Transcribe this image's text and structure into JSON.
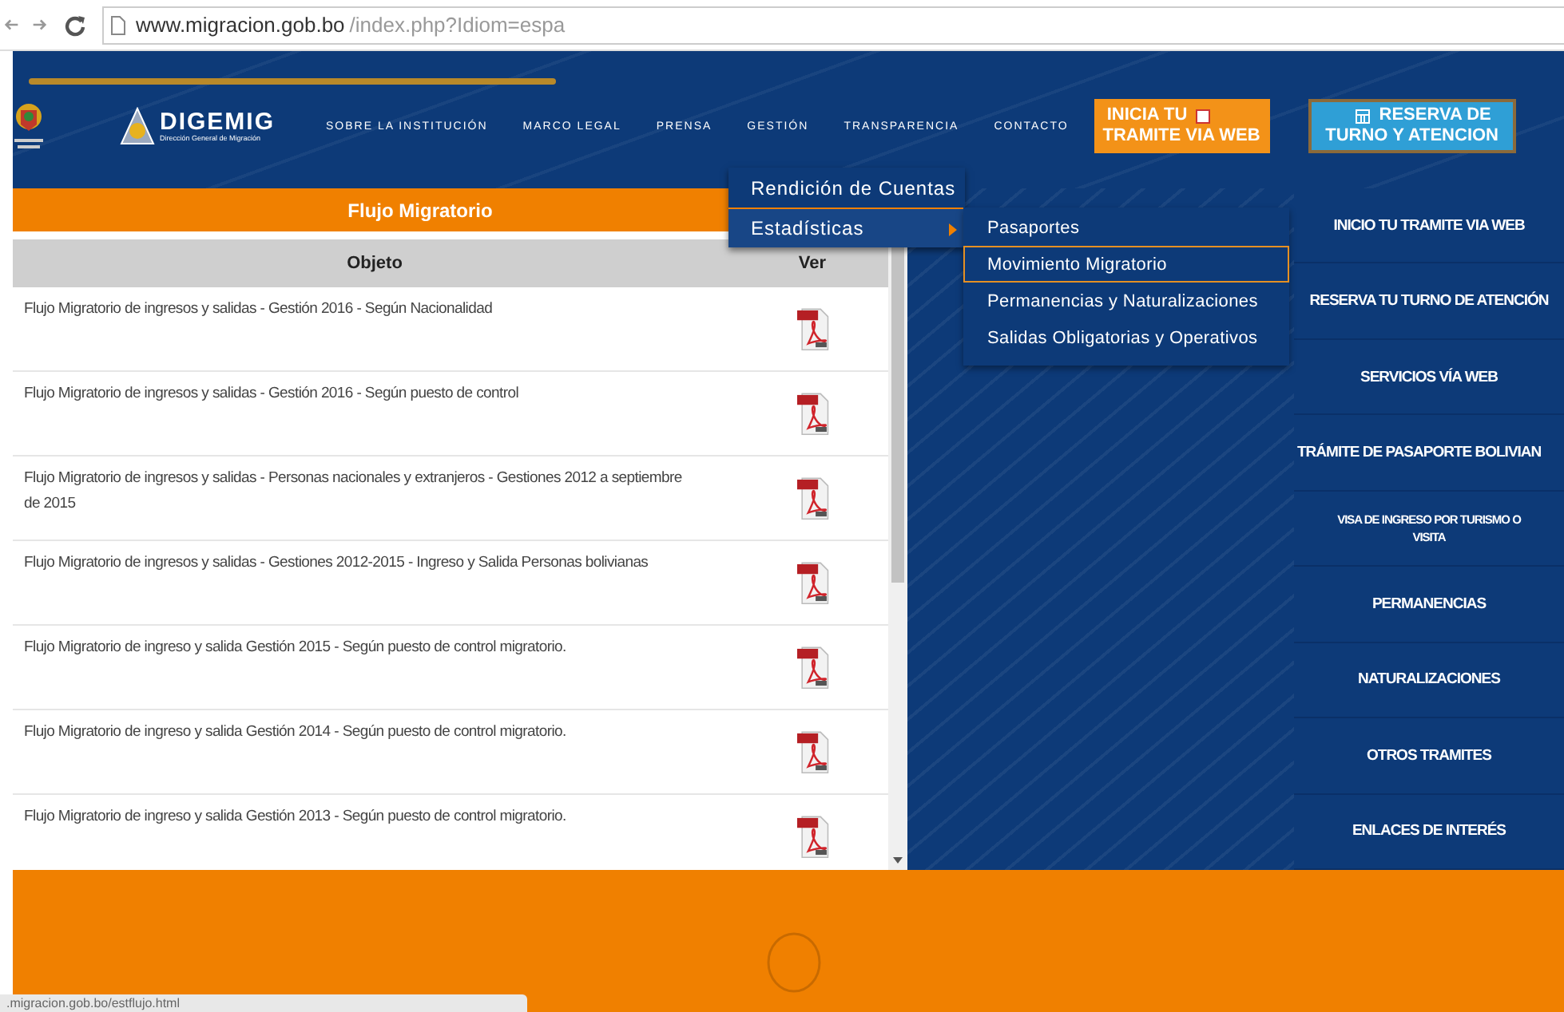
{
  "browser": {
    "url_host": "www.migracion.gob.bo",
    "url_path": "/index.php?Idiom=espa"
  },
  "header": {
    "logo_name": "DIGEMIG",
    "logo_tagline": "Dirección General de Migración",
    "nav": [
      "SOBRE LA INSTITUCIÓN",
      "MARCO LEGAL",
      "PRENSA",
      "GESTIÓN",
      "TRANSPARENCIA",
      "CONTACTO"
    ]
  },
  "banners": [
    {
      "kind": "orange",
      "lines": [
        "INICIA TU",
        "TRAMITE VIA WEB"
      ]
    },
    {
      "kind": "blue",
      "lines": [
        "RESERVA DE",
        "TURNO Y ATENCION"
      ]
    }
  ],
  "menu": {
    "items": [
      {
        "label": "Rendición de Cuentas",
        "selected": false,
        "has_submenu": false
      },
      {
        "label": "Estadísticas",
        "selected": true,
        "has_submenu": true
      }
    ],
    "submenu": [
      {
        "label": "Pasaportes",
        "selected": false
      },
      {
        "label": "Movimiento Migratorio",
        "selected": true
      },
      {
        "label": "Permanencias y Naturalizaciones",
        "selected": false
      },
      {
        "label": "Salidas Obligatorias y Operativos",
        "selected": false
      }
    ]
  },
  "panel": {
    "title": "Flujo Migratorio",
    "columns": [
      "Objeto",
      "Ver"
    ],
    "rows": [
      {
        "text": "Flujo Migratorio de ingresos y salidas - Gestión 2016 - Según Nacionalidad"
      },
      {
        "text": "Flujo Migratorio de ingresos y salidas - Gestión 2016 - Según puesto de control"
      },
      {
        "text": "Flujo Migratorio de ingresos y salidas - Personas nacionales y extranjeros - Gestiones 2012 a septiembre de 2015"
      },
      {
        "text": "Flujo Migratorio de ingresos y salidas - Gestiones 2012-2015 - Ingreso y Salida Personas bolivianas"
      },
      {
        "text": "Flujo Migratorio de ingreso y salida Gestión 2015 - Según puesto de control migratorio."
      },
      {
        "text": "Flujo Migratorio de ingreso y salida Gestión 2014 - Según puesto de control migratorio."
      },
      {
        "text": "Flujo Migratorio de ingreso y salida Gestión 2013 - Según puesto de control migratorio."
      }
    ]
  },
  "sidebar": [
    {
      "label": "INICIO TU TRAMITE VIA WEB",
      "kind": "normal"
    },
    {
      "label": "RESERVA TU TURNO DE ATENCIÓN",
      "kind": "normal"
    },
    {
      "label": "SERVICIOS VÍA WEB",
      "kind": "normal"
    },
    {
      "label": "TRÁMITE DE PASAPORTE BOLIVIAN",
      "kind": "normal"
    },
    {
      "label": "VISA DE INGRESO POR TURISMO O VISITA",
      "kind": "small"
    },
    {
      "label": "PERMANENCIAS",
      "kind": "normal"
    },
    {
      "label": "NATURALIZACIONES",
      "kind": "normal"
    },
    {
      "label": "OTROS TRAMITES",
      "kind": "normal"
    },
    {
      "label": "ENLACES DE INTERÉS",
      "kind": "normal"
    }
  ],
  "status_bar": ".migracion.gob.bo/estflujo.html"
}
